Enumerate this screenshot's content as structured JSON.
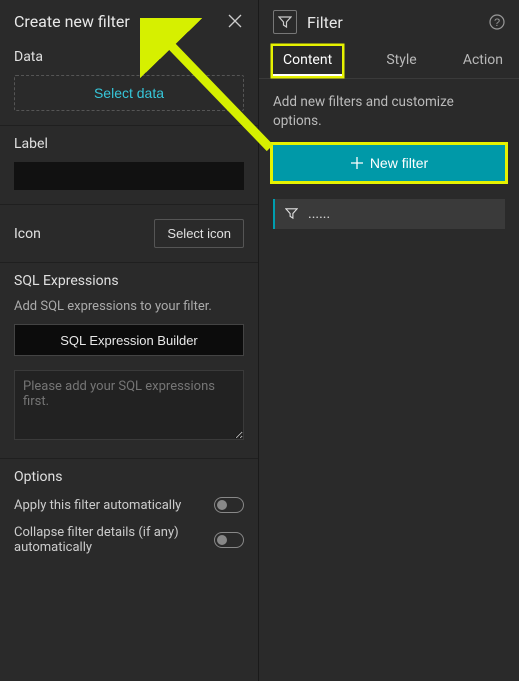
{
  "left": {
    "title": "Create new filter",
    "data": {
      "heading": "Data",
      "selectButton": "Select data"
    },
    "label": {
      "heading": "Label",
      "value": ""
    },
    "icon": {
      "heading": "Icon",
      "selectButton": "Select icon"
    },
    "sql": {
      "heading": "SQL Expressions",
      "help": "Add SQL expressions to your filter.",
      "builderButton": "SQL Expression Builder",
      "placeholder": "Please add your SQL expressions first."
    },
    "options": {
      "heading": "Options",
      "applyAuto": "Apply this filter automatically",
      "collapseAuto": "Collapse filter details (if any) automatically"
    }
  },
  "right": {
    "title": "Filter",
    "tabs": {
      "content": "Content",
      "style": "Style",
      "action": "Action"
    },
    "description": "Add new filters and customize options.",
    "newFilterButton": "New filter",
    "filterItem": {
      "label": "......"
    }
  }
}
